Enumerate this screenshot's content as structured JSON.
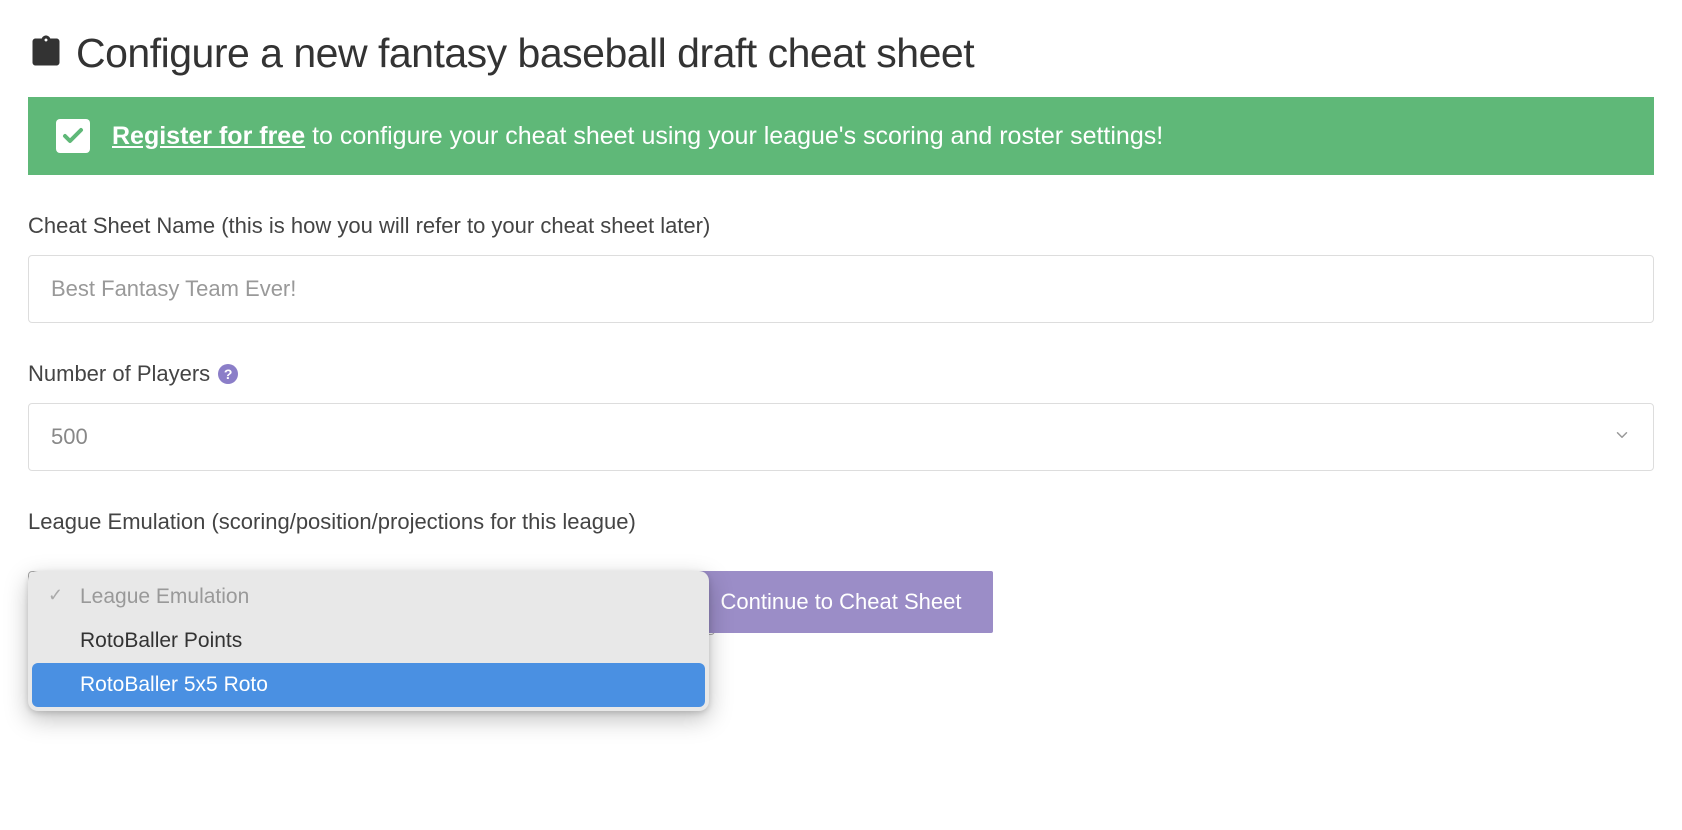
{
  "header": {
    "title": "Configure a new fantasy baseball draft cheat sheet"
  },
  "alert": {
    "link_text": "Register for free",
    "message": " to configure your cheat sheet using your league's scoring and roster settings!"
  },
  "form": {
    "sheet_name": {
      "label": "Cheat Sheet Name (this is how you will refer to your cheat sheet later)",
      "placeholder": "Best Fantasy Team Ever!",
      "value": ""
    },
    "num_players": {
      "label": "Number of Players",
      "value": "500"
    },
    "league_emulation": {
      "label": "League Emulation (scoring/position/projections for this league)",
      "placeholder_option": "League Emulation",
      "options": [
        "RotoBaller Points",
        "RotoBaller 5x5 Roto"
      ],
      "highlighted_index": 1
    },
    "submit_label": "Continue to Cheat Sheet"
  }
}
